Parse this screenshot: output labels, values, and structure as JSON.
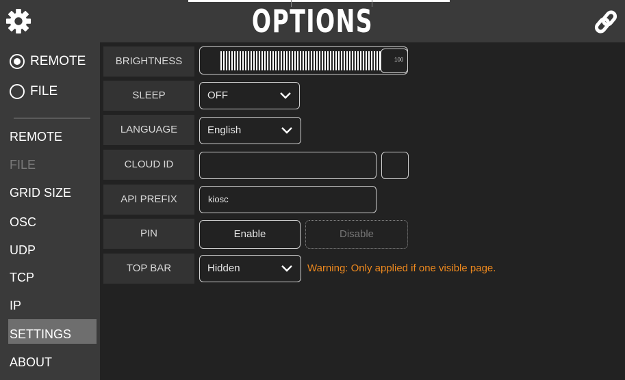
{
  "header": {
    "title": "OPTIONS",
    "left_icon": "gear-icon",
    "right_icon": "link-icon"
  },
  "sidebar": {
    "radios": [
      {
        "label": "REMOTE",
        "selected": true
      },
      {
        "label": "FILE",
        "selected": false
      }
    ],
    "items": [
      {
        "label": "REMOTE",
        "state": "normal"
      },
      {
        "label": "FILE",
        "state": "disabled"
      },
      {
        "label": "GRID SIZE",
        "state": "normal"
      },
      {
        "label": "OSC",
        "state": "normal"
      },
      {
        "label": "UDP",
        "state": "normal"
      },
      {
        "label": "TCP",
        "state": "normal"
      },
      {
        "label": "IP",
        "state": "normal"
      },
      {
        "label": "SETTINGS",
        "state": "active"
      },
      {
        "label": "ABOUT",
        "state": "normal"
      }
    ]
  },
  "settings": {
    "brightness": {
      "label": "BRIGHTNESS",
      "value": "100"
    },
    "sleep": {
      "label": "SLEEP",
      "value": "OFF"
    },
    "language": {
      "label": "LANGUAGE",
      "value": "English"
    },
    "cloud_id": {
      "label": "CLOUD ID",
      "value": ""
    },
    "api_prefix": {
      "label": "API PREFIX",
      "value": "kiosc"
    },
    "pin": {
      "label": "PIN",
      "enable_label": "Enable",
      "disable_label": "Disable"
    },
    "top_bar": {
      "label": "TOP BAR",
      "value": "Hidden",
      "warning": "Warning: Only applied if one visible page."
    }
  },
  "colors": {
    "background": "#222222",
    "panel": "#3a3a3a",
    "label_bg": "#333333",
    "active": "#6e6e6e",
    "warning": "#f08a1e"
  }
}
